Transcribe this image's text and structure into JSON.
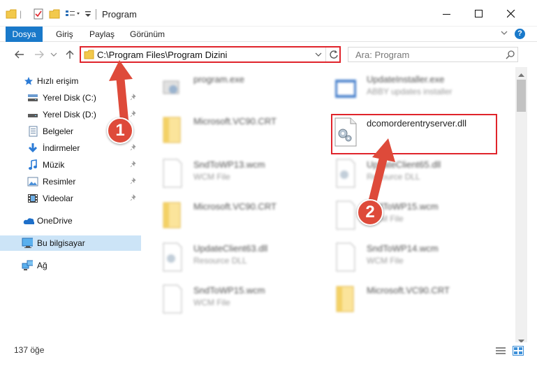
{
  "window": {
    "title": "Program"
  },
  "ribbon": {
    "tabs": [
      {
        "label": "Dosya"
      },
      {
        "label": "Giriş"
      },
      {
        "label": "Paylaş"
      },
      {
        "label": "Görünüm"
      }
    ]
  },
  "navbar": {
    "address": "C:\\Program Files\\Program Dizini",
    "search_placeholder": "Ara: Program"
  },
  "sidebar": {
    "items": [
      {
        "label": "Hızlı erişim",
        "icon": "star-icon"
      },
      {
        "label": "Yerel Disk (C:)",
        "icon": "drive-icon"
      },
      {
        "label": "Yerel Disk (D:)",
        "icon": "drive-icon"
      },
      {
        "label": "Belgeler",
        "icon": "documents-icon"
      },
      {
        "label": "İndirmeler",
        "icon": "download-icon"
      },
      {
        "label": "Müzik",
        "icon": "music-icon"
      },
      {
        "label": "Resimler",
        "icon": "pictures-icon"
      },
      {
        "label": "Videolar",
        "icon": "videos-icon"
      },
      {
        "label": "OneDrive",
        "icon": "cloud-icon"
      },
      {
        "label": "Bu bilgisayar",
        "icon": "computer-icon"
      },
      {
        "label": "Ağ",
        "icon": "network-icon"
      }
    ]
  },
  "files": [
    {
      "name": "program.exe",
      "type": ""
    },
    {
      "name": "UpdateInstaller.exe",
      "type": "ABBY updates installer"
    },
    {
      "name": "Microsoft.VC90.CRT",
      "type": ""
    },
    {
      "name": "dcomorderentryserver.dll",
      "type": ""
    },
    {
      "name": "SndToWP13.wcm",
      "type": "WCM File"
    },
    {
      "name": "UpdateClient65.dll",
      "type": "Resource DLL"
    },
    {
      "name": "Microsoft.VC90.CRT",
      "type": ""
    },
    {
      "name": "SndToWP15.wcm",
      "type": "WCM File"
    },
    {
      "name": "UpdateClient63.dll",
      "type": "Resource DLL"
    },
    {
      "name": "SndToWP14.wcm",
      "type": "WCM File"
    },
    {
      "name": "SndToWP15.wcm",
      "type": "WCM File"
    },
    {
      "name": "Microsoft.VC90.CRT",
      "type": ""
    }
  ],
  "status": {
    "item_count": "137 öğe"
  },
  "annotations": {
    "badge1": "1",
    "badge2": "2"
  },
  "colors": {
    "accent": "#1979ca",
    "highlight": "#e0242b",
    "badge": "#de4a3a"
  }
}
